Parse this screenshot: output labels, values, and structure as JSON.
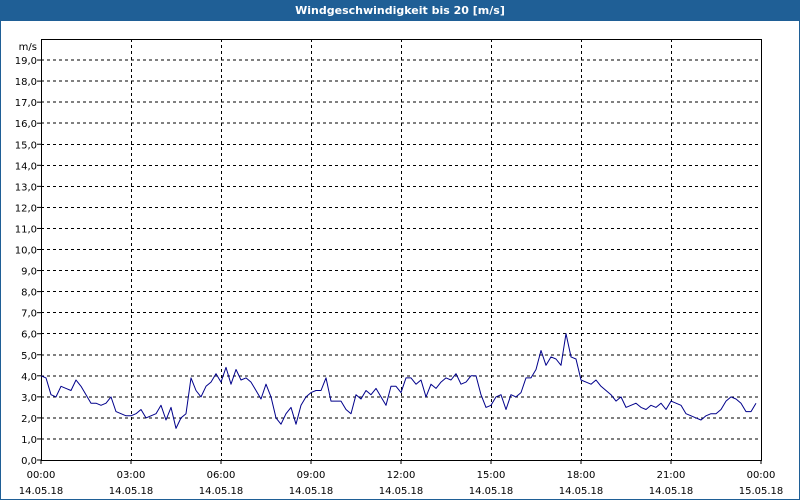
{
  "window": {
    "title": "Windgeschwindigkeit bis 20 [m/s]"
  },
  "chart_data": {
    "type": "line",
    "title": "Windgeschwindigkeit bis 20 [m/s]",
    "ylabel": "m/s",
    "xlabel": "",
    "ylim": [
      0,
      20
    ],
    "xlim_hours": [
      0,
      24
    ],
    "grid": true,
    "line_color": "#00008b",
    "y_ticks": [
      "0,0",
      "1,0",
      "2,0",
      "3,0",
      "4,0",
      "5,0",
      "6,0",
      "7,0",
      "8,0",
      "9,0",
      "10,0",
      "11,0",
      "12,0",
      "13,0",
      "14,0",
      "15,0",
      "16,0",
      "17,0",
      "18,0",
      "19,0"
    ],
    "x_ticks": [
      {
        "time": "00:00",
        "date": "14.05.18"
      },
      {
        "time": "03:00",
        "date": "14.05.18"
      },
      {
        "time": "06:00",
        "date": "14.05.18"
      },
      {
        "time": "09:00",
        "date": "14.05.18"
      },
      {
        "time": "12:00",
        "date": "14.05.18"
      },
      {
        "time": "15:00",
        "date": "14.05.18"
      },
      {
        "time": "18:00",
        "date": "14.05.18"
      },
      {
        "time": "21:00",
        "date": "14.05.18"
      },
      {
        "time": "00:00",
        "date": "15.05.18"
      }
    ],
    "series": [
      {
        "x": [
          "00:00",
          "00:10",
          "00:20",
          "00:30",
          "00:40",
          "00:50",
          "01:00",
          "01:10",
          "01:20",
          "01:30",
          "01:40",
          "01:50",
          "02:00",
          "02:10",
          "02:20",
          "02:30",
          "02:40",
          "02:50",
          "03:00",
          "03:10",
          "03:20",
          "03:30",
          "03:40",
          "03:50",
          "04:00",
          "04:10",
          "04:20",
          "04:30",
          "04:40",
          "04:50",
          "05:00",
          "05:10",
          "05:20",
          "05:30",
          "05:40",
          "05:50",
          "06:00",
          "06:10",
          "06:20",
          "06:30",
          "06:40",
          "06:50",
          "07:00",
          "07:10",
          "07:20",
          "07:30",
          "07:40",
          "07:50",
          "08:00",
          "08:10",
          "08:20",
          "08:30",
          "08:40",
          "08:50",
          "09:00",
          "09:10",
          "09:20",
          "09:30",
          "09:40",
          "09:50",
          "10:00",
          "10:10",
          "10:20",
          "10:30",
          "10:40",
          "10:50",
          "11:00",
          "11:10",
          "11:20",
          "11:30",
          "11:40",
          "11:50",
          "12:00",
          "12:10",
          "12:20",
          "12:30",
          "12:40",
          "12:50",
          "13:00",
          "13:10",
          "13:20",
          "13:30",
          "13:40",
          "13:50",
          "14:00",
          "14:10",
          "14:20",
          "14:30",
          "14:40",
          "14:50",
          "15:00",
          "15:10",
          "15:20",
          "15:30",
          "15:40",
          "15:50",
          "16:00",
          "16:10",
          "16:20",
          "16:30",
          "16:40",
          "16:50",
          "17:00",
          "17:10",
          "17:20",
          "17:30",
          "17:40",
          "17:50",
          "18:00",
          "18:10",
          "18:20",
          "18:30",
          "18:40",
          "18:50",
          "19:00",
          "19:10",
          "19:20",
          "19:30",
          "19:40",
          "19:50",
          "20:00",
          "20:10",
          "20:20",
          "20:30",
          "20:40",
          "20:50",
          "21:00",
          "21:10",
          "21:20",
          "21:30",
          "21:40",
          "21:50",
          "22:00",
          "22:10",
          "22:20",
          "22:30",
          "22:40",
          "22:50",
          "23:00",
          "23:10",
          "23:20",
          "23:30",
          "23:40",
          "23:50"
        ],
        "values": [
          4.0,
          3.9,
          3.1,
          3.0,
          3.5,
          3.4,
          3.3,
          3.8,
          3.5,
          3.1,
          2.7,
          2.7,
          2.6,
          2.7,
          3.0,
          2.3,
          2.2,
          2.1,
          2.1,
          2.2,
          2.4,
          2.0,
          2.1,
          2.2,
          2.6,
          1.9,
          2.5,
          1.5,
          2.0,
          2.2,
          3.9,
          3.3,
          3.0,
          3.5,
          3.7,
          4.1,
          3.7,
          4.4,
          3.6,
          4.3,
          3.8,
          3.9,
          3.7,
          3.3,
          2.9,
          3.6,
          3.0,
          2.0,
          1.7,
          2.2,
          2.5,
          1.7,
          2.6,
          3.0,
          3.2,
          3.3,
          3.3,
          3.9,
          2.8,
          2.8,
          2.8,
          2.4,
          2.2,
          3.1,
          2.9,
          3.3,
          3.1,
          3.4,
          3.0,
          2.6,
          3.5,
          3.5,
          3.2,
          3.9,
          3.9,
          3.6,
          3.8,
          3.0,
          3.6,
          3.4,
          3.7,
          3.9,
          3.8,
          4.1,
          3.6,
          3.7,
          4.0,
          4.0,
          3.1,
          2.5,
          2.6,
          3.0,
          3.1,
          2.4,
          3.1,
          3.0,
          3.2,
          3.9,
          3.9,
          4.3,
          5.2,
          4.5,
          4.9,
          4.8,
          4.5,
          6.0,
          4.9,
          4.8,
          3.8,
          3.7,
          3.6,
          3.8,
          3.5,
          3.3,
          3.1,
          2.8,
          3.0,
          2.5,
          2.6,
          2.7,
          2.5,
          2.4,
          2.6,
          2.5,
          2.7,
          2.4,
          2.8,
          2.7,
          2.6,
          2.2,
          2.1,
          2.0,
          1.9,
          2.1,
          2.2,
          2.2,
          2.4,
          2.8,
          3.0,
          2.9,
          2.7,
          2.3,
          2.3,
          2.7
        ]
      }
    ]
  }
}
